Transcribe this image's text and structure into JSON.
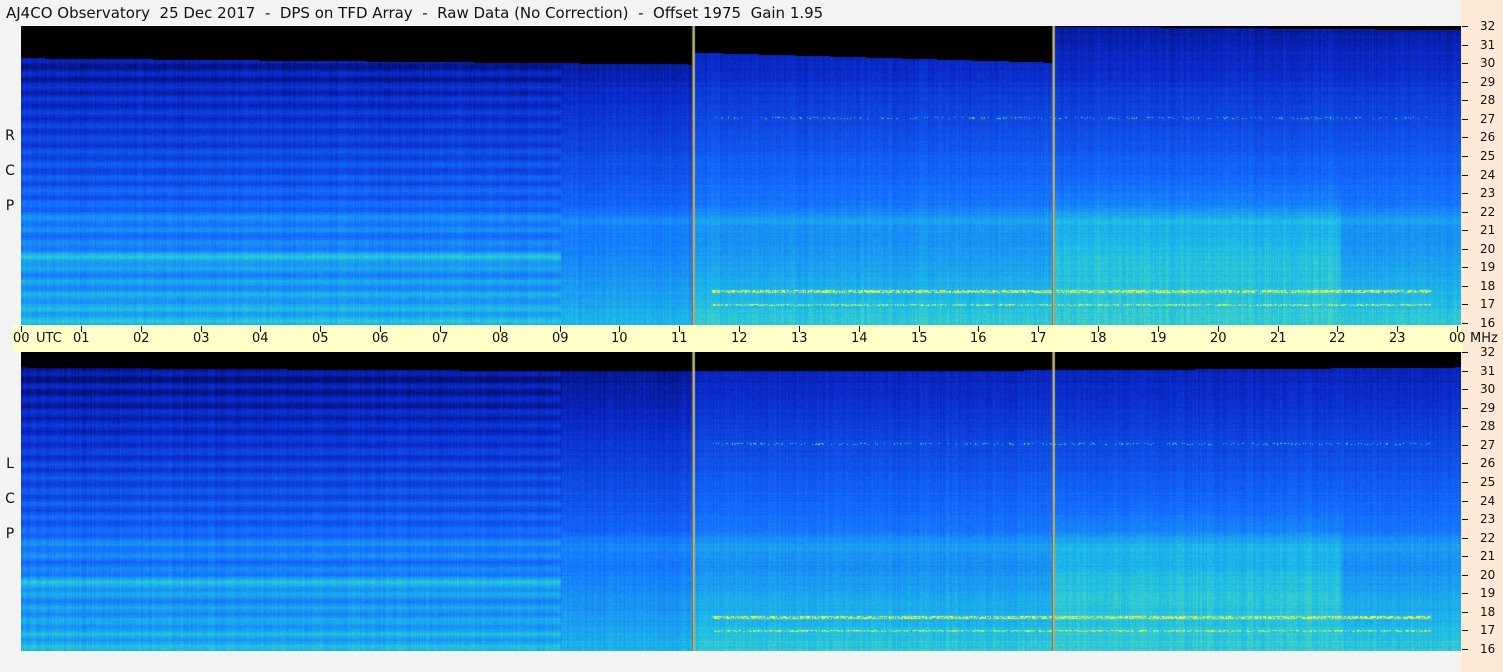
{
  "title": "AJ4CO Observatory  25 Dec 2017  -  DPS on TFD Array  -  Raw Data (No Correction)  -  Offset 1975  Gain 1.95",
  "colors": {
    "background": "#f3f3f3",
    "time_bar": "#ffffc8",
    "freq_strip": "#fde9d6",
    "spectrogram_low": "#000000",
    "spectrogram_mid": "#1060ff",
    "spectrogram_high": "#ffff40",
    "gap_line_red": "#ff3030",
    "gap_line_green": "#40ff80"
  },
  "panels": [
    {
      "id": "rcp",
      "polarization": "R C P",
      "letters": [
        "R",
        "C",
        "P"
      ]
    },
    {
      "id": "lcp",
      "polarization": "L C P",
      "letters": [
        "L",
        "C",
        "P"
      ]
    }
  ],
  "chart_data": {
    "type": "heatmap",
    "title": "AJ4CO Observatory  25 Dec 2017  -  DPS on TFD Array  -  Raw Data (No Correction)  -  Offset 1975  Gain 1.95",
    "x_axis": {
      "unit": "UTC",
      "tick_labels": [
        "00",
        "01",
        "02",
        "03",
        "04",
        "05",
        "06",
        "07",
        "08",
        "09",
        "10",
        "11",
        "12",
        "13",
        "14",
        "15",
        "16",
        "17",
        "18",
        "19",
        "20",
        "21",
        "22",
        "23",
        "00"
      ],
      "range_hours": [
        0,
        24
      ]
    },
    "y_axis": {
      "unit": "MHz",
      "tick_labels": [
        "16",
        "17",
        "18",
        "19",
        "20",
        "21",
        "22",
        "23",
        "24",
        "25",
        "26",
        "27",
        "28",
        "29",
        "30",
        "31",
        "32"
      ],
      "range": [
        16,
        32
      ]
    },
    "series": [
      {
        "name": "R C P"
      },
      {
        "name": "L C P"
      }
    ],
    "vertical_markers_utc": [
      11.2,
      17.2
    ]
  }
}
